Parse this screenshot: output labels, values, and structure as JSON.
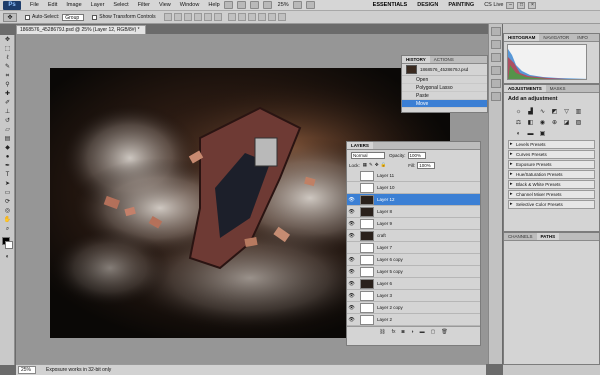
{
  "menu": {
    "logo": "Ps",
    "items": [
      "File",
      "Edit",
      "Image",
      "Layer",
      "Select",
      "Filter",
      "View",
      "Window",
      "Help"
    ],
    "zoom": "25%",
    "workspaces": [
      "ESSENTIALS",
      "DESIGN",
      "PAINTING"
    ],
    "cs_live": "CS Live"
  },
  "options": {
    "auto_select_label": "Auto-Select:",
    "auto_select_value": "Group",
    "transform_label": "Show Transform Controls"
  },
  "document": {
    "tab_title": "1868576_4528679J.psd @ 25% (Layer 12, RGB/8#) *",
    "status_zoom": "25%",
    "status_info": "Exposure works in 32-bit only"
  },
  "history": {
    "tabs": [
      "HISTORY",
      "ACTIONS"
    ],
    "snapshot": "1868576_4528679J.psd",
    "steps": [
      "Open",
      "Polygonal Lasso",
      "Paste",
      "Move"
    ],
    "selected_index": 3
  },
  "layers": {
    "tab": "LAYERS",
    "blend_mode": "Normal",
    "opacity_label": "Opacity:",
    "opacity": "100%",
    "lock_label": "Lock:",
    "fill_label": "Fill:",
    "fill": "100%",
    "items": [
      {
        "name": "Layer 11",
        "visible": false,
        "dark": false,
        "selected": false
      },
      {
        "name": "Layer 10",
        "visible": false,
        "dark": false,
        "selected": false
      },
      {
        "name": "Layer 12",
        "visible": true,
        "dark": true,
        "selected": true
      },
      {
        "name": "Layer 8",
        "visible": true,
        "dark": true,
        "selected": false
      },
      {
        "name": "Layer 9",
        "visible": true,
        "dark": false,
        "selected": false
      },
      {
        "name": "craft",
        "visible": true,
        "dark": true,
        "selected": false
      },
      {
        "name": "Layer 7",
        "visible": false,
        "dark": false,
        "selected": false
      },
      {
        "name": "Layer 6 copy",
        "visible": true,
        "dark": false,
        "selected": false
      },
      {
        "name": "Layer 5 copy",
        "visible": true,
        "dark": false,
        "selected": false
      },
      {
        "name": "Layer 6",
        "visible": true,
        "dark": true,
        "selected": false
      },
      {
        "name": "Layer 3",
        "visible": true,
        "dark": false,
        "selected": false
      },
      {
        "name": "Layer 2 copy",
        "visible": true,
        "dark": false,
        "selected": false
      },
      {
        "name": "Layer 2",
        "visible": true,
        "dark": false,
        "selected": false
      }
    ]
  },
  "right_panels": {
    "histogram_tabs": [
      "HISTOGRAM",
      "NAVIGATOR",
      "INFO"
    ],
    "adjustments_tabs": [
      "ADJUSTMENTS",
      "MASKS"
    ],
    "adjust_title": "Add an adjustment",
    "presets": [
      "Levels Presets",
      "Curves Presets",
      "Exposure Presets",
      "Hue/Saturation Presets",
      "Black & White Presets",
      "Channel Mixer Presets",
      "Selective Color Presets"
    ],
    "bottom_tabs": [
      "CHANNELS",
      "PATHS"
    ]
  },
  "colors": {
    "selection_blue": "#3b7fd4",
    "panel_gray": "#d4d4d4",
    "canvas_dark": "#1a120c"
  }
}
